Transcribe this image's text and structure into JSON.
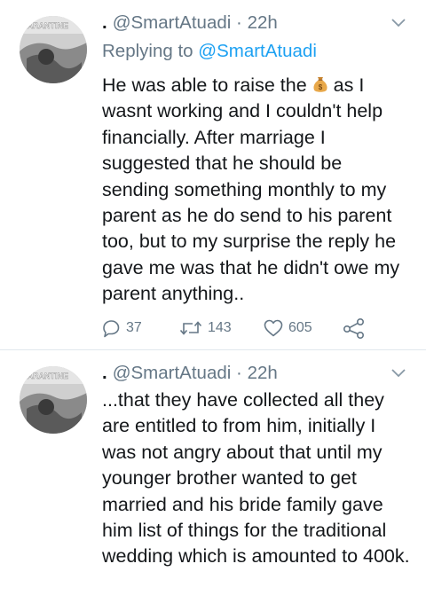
{
  "tweets": [
    {
      "dot": ".",
      "handle": "@SmartAtuadi",
      "separator": "·",
      "time": "22h",
      "replying_label": "Replying to",
      "replying_to": "@SmartAtuadi",
      "avatar_text": "UARANTINE",
      "text_before_emoji": "He was able to raise the",
      "emoji": "money-bag-emoji",
      "text_after_emoji": "as I wasnt working and I couldn't help financially. After marriage I suggested that he should be sending something monthly to my parent as he do send to his parent too, but to my surprise the reply he gave me was that he didn't owe my parent anything..",
      "reply_count": "37",
      "retweet_count": "143",
      "like_count": "605"
    },
    {
      "dot": ".",
      "handle": "@SmartAtuadi",
      "separator": "·",
      "time": "22h",
      "avatar_text": "UARANTINE",
      "text": "...that they have collected all they are entitled to from him, initially I was not angry about that until my younger brother wanted to get married and his bride family gave him list of things for the traditional wedding which is amounted to 400k."
    }
  ],
  "colors": {
    "text": "#14171a",
    "muted": "#657786",
    "accent": "#1da1f2",
    "divider": "#e1e8ed"
  },
  "icons": [
    "reply-icon",
    "retweet-icon",
    "like-icon",
    "share-icon",
    "chevron-down-icon",
    "money-bag-emoji"
  ]
}
